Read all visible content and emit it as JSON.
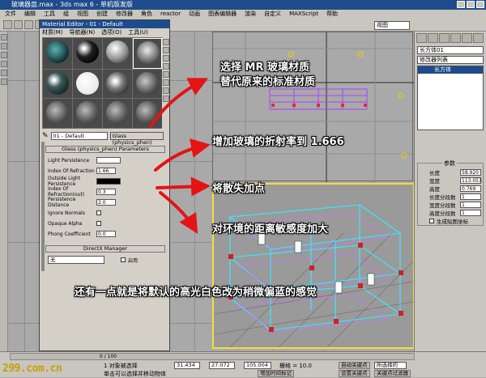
{
  "window": {
    "title": "玻璃器皿.max - 3ds max 6 - 单机版发版"
  },
  "menubar": [
    "文件",
    "编辑",
    "工具",
    "组",
    "视图",
    "创建",
    "修改器",
    "角色",
    "reactor",
    "动画",
    "图表编辑器",
    "渲染",
    "自定义",
    "MAXScript",
    "帮助"
  ],
  "toolbar": {
    "view_select": "视图"
  },
  "material_editor": {
    "title": "Material Editor - 01 - Default",
    "menu": [
      "材质(M)",
      "导航器(N)",
      "选项(O)",
      "工具(U)"
    ],
    "material_name": "01 - Default",
    "material_type": "Glass (physics_phen)",
    "rollout_title": "Glass (physics_phen) Parameters",
    "params": [
      {
        "label": "Light Persistence",
        "value": "",
        "type": "color-white"
      },
      {
        "label": "Index Of Refraction",
        "value": "1.66",
        "type": "spinner"
      },
      {
        "label": "Outside Light Persistence",
        "value": "",
        "type": "color-black"
      },
      {
        "label": "Index Of Refraction(out)",
        "value": "0.3",
        "type": "spinner"
      },
      {
        "label": "Persistence Distance",
        "value": "2.0",
        "type": "spinner"
      },
      {
        "label": "Ignore Normals",
        "value": "",
        "type": "check"
      },
      {
        "label": "Opaque Alpha",
        "value": "",
        "type": "check"
      },
      {
        "label": "Phong Coefficient",
        "value": "0.0",
        "type": "spinner"
      }
    ],
    "directx_rollout": "DirectX Manager",
    "directx_select": "无",
    "directx_check": "启用"
  },
  "command_panel": {
    "object_name": "长方体01",
    "modifier_list": "修改器列表",
    "stack_item": "长方体",
    "params_title": "参数",
    "params": [
      {
        "label": "长度",
        "value": "58.920"
      },
      {
        "label": "宽度",
        "value": "113.053"
      },
      {
        "label": "高度",
        "value": "0.769"
      },
      {
        "label": "长度分段数",
        "value": "1"
      },
      {
        "label": "宽度分段数",
        "value": "1"
      },
      {
        "label": "高度分段数",
        "value": "1"
      }
    ],
    "gen_uv": "生成贴图坐标"
  },
  "statusbar": {
    "frame_counter": "0 / 100",
    "selection": "1 对象被选择",
    "x": "31.434",
    "y": "27.072",
    "z": "105.004",
    "grid": "栅格 = 10.0",
    "autokey": "自动关键点",
    "selected": "所选择的",
    "setkey": "设置关键点",
    "filter": "关键点过滤器",
    "prompt": "单击可以选择并移动物体",
    "addtime": "增加时间标记"
  },
  "watermark": "299.com.cn",
  "annotations": [
    "选择 MR 玻璃材质",
    "替代原来的标准材质",
    "增加玻璃的折射率到 1.666",
    "将散失加点",
    "对环境的距离敏感度加大",
    "还有一点就是将默认的高光白色改为稍微偏蓝的感觉"
  ]
}
